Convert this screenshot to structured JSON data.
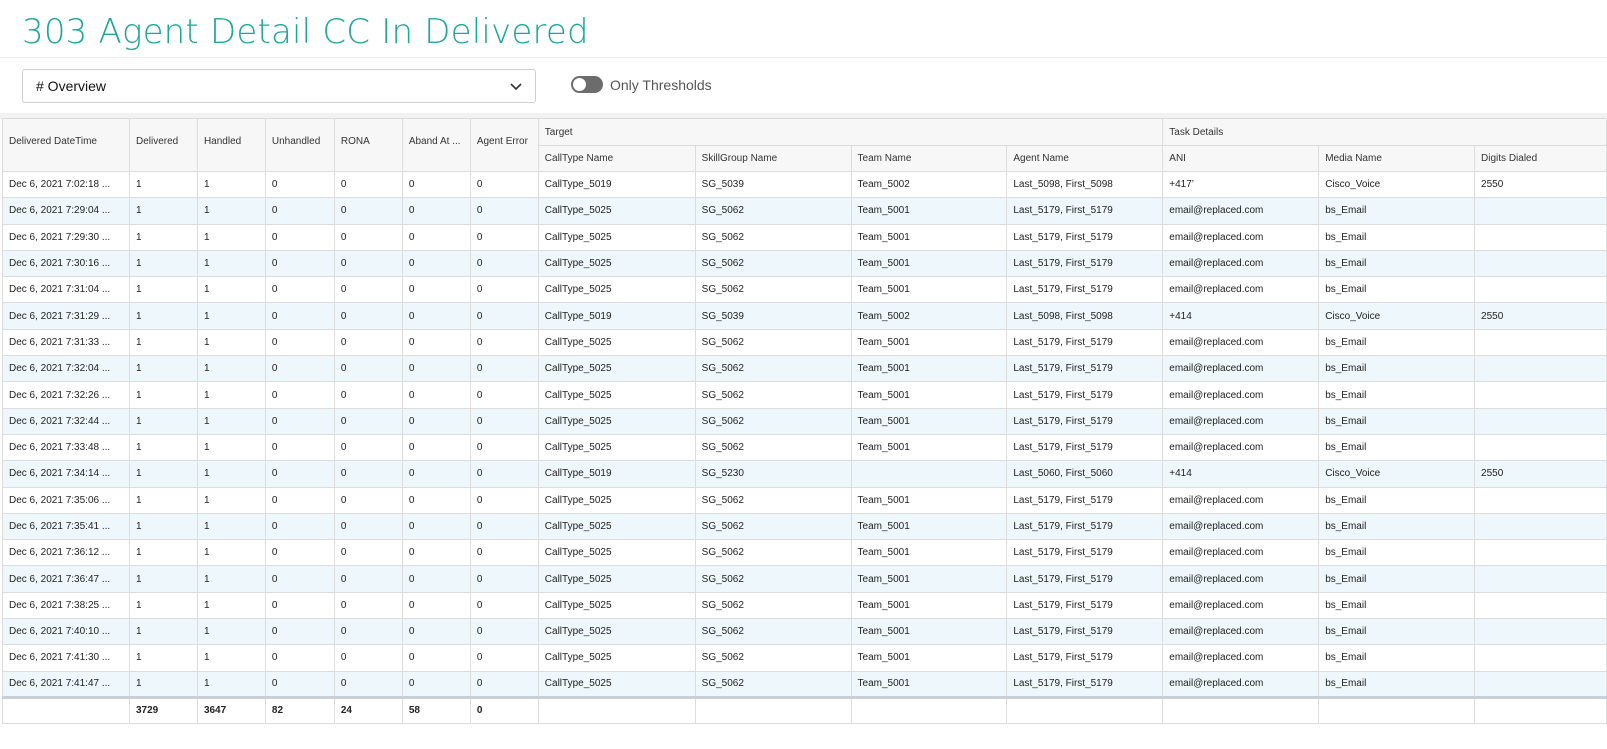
{
  "page": {
    "title": "303 Agent Detail CC In Delivered"
  },
  "view_select": {
    "value": "# Overview"
  },
  "thresholds_toggle": {
    "label": "Only Thresholds",
    "on": false
  },
  "grid": {
    "groups": {
      "target": "Target",
      "task": "Task Details"
    },
    "columns": {
      "datetime": "Delivered DateTime",
      "delivered": "Delivered",
      "handled": "Handled",
      "unhandled": "Unhandled",
      "rona": "RONA",
      "aband": "Aband At ...",
      "agent_error": "Agent Error",
      "calltype": "CallType Name",
      "skillgroup": "SkillGroup Name",
      "team": "Team Name",
      "agent": "Agent Name",
      "ani": "ANI",
      "media": "Media Name",
      "digits": "Digits Dialed"
    },
    "rows": [
      [
        "Dec 6, 2021 7:02:18 ...",
        "1",
        "1",
        "0",
        "0",
        "0",
        "0",
        "CallType_5019",
        "SG_5039",
        "Team_5002",
        "Last_5098, First_5098",
        "+417’",
        "Cisco_Voice",
        "2550"
      ],
      [
        "Dec 6, 2021 7:29:04 ...",
        "1",
        "1",
        "0",
        "0",
        "0",
        "0",
        "CallType_5025",
        "SG_5062",
        "Team_5001",
        "Last_5179, First_5179",
        "email@replaced.com",
        "bs_Email",
        ""
      ],
      [
        "Dec 6, 2021 7:29:30 ...",
        "1",
        "1",
        "0",
        "0",
        "0",
        "0",
        "CallType_5025",
        "SG_5062",
        "Team_5001",
        "Last_5179, First_5179",
        "email@replaced.com",
        "bs_Email",
        ""
      ],
      [
        "Dec 6, 2021 7:30:16 ...",
        "1",
        "1",
        "0",
        "0",
        "0",
        "0",
        "CallType_5025",
        "SG_5062",
        "Team_5001",
        "Last_5179, First_5179",
        "email@replaced.com",
        "bs_Email",
        ""
      ],
      [
        "Dec 6, 2021 7:31:04 ...",
        "1",
        "1",
        "0",
        "0",
        "0",
        "0",
        "CallType_5025",
        "SG_5062",
        "Team_5001",
        "Last_5179, First_5179",
        "email@replaced.com",
        "bs_Email",
        ""
      ],
      [
        "Dec 6, 2021 7:31:29 ...",
        "1",
        "1",
        "0",
        "0",
        "0",
        "0",
        "CallType_5019",
        "SG_5039",
        "Team_5002",
        "Last_5098, First_5098",
        "+414",
        "Cisco_Voice",
        "2550"
      ],
      [
        "Dec 6, 2021 7:31:33 ...",
        "1",
        "1",
        "0",
        "0",
        "0",
        "0",
        "CallType_5025",
        "SG_5062",
        "Team_5001",
        "Last_5179, First_5179",
        "email@replaced.com",
        "bs_Email",
        ""
      ],
      [
        "Dec 6, 2021 7:32:04 ...",
        "1",
        "1",
        "0",
        "0",
        "0",
        "0",
        "CallType_5025",
        "SG_5062",
        "Team_5001",
        "Last_5179, First_5179",
        "email@replaced.com",
        "bs_Email",
        ""
      ],
      [
        "Dec 6, 2021 7:32:26 ...",
        "1",
        "1",
        "0",
        "0",
        "0",
        "0",
        "CallType_5025",
        "SG_5062",
        "Team_5001",
        "Last_5179, First_5179",
        "email@replaced.com",
        "bs_Email",
        ""
      ],
      [
        "Dec 6, 2021 7:32:44 ...",
        "1",
        "1",
        "0",
        "0",
        "0",
        "0",
        "CallType_5025",
        "SG_5062",
        "Team_5001",
        "Last_5179, First_5179",
        "email@replaced.com",
        "bs_Email",
        ""
      ],
      [
        "Dec 6, 2021 7:33:48 ...",
        "1",
        "1",
        "0",
        "0",
        "0",
        "0",
        "CallType_5025",
        "SG_5062",
        "Team_5001",
        "Last_5179, First_5179",
        "email@replaced.com",
        "bs_Email",
        ""
      ],
      [
        "Dec 6, 2021 7:34:14 ...",
        "1",
        "1",
        "0",
        "0",
        "0",
        "0",
        "CallType_5019",
        "SG_5230",
        "",
        "Last_5060, First_5060",
        "+414",
        "Cisco_Voice",
        "2550"
      ],
      [
        "Dec 6, 2021 7:35:06 ...",
        "1",
        "1",
        "0",
        "0",
        "0",
        "0",
        "CallType_5025",
        "SG_5062",
        "Team_5001",
        "Last_5179, First_5179",
        "email@replaced.com",
        "bs_Email",
        ""
      ],
      [
        "Dec 6, 2021 7:35:41 ...",
        "1",
        "1",
        "0",
        "0",
        "0",
        "0",
        "CallType_5025",
        "SG_5062",
        "Team_5001",
        "Last_5179, First_5179",
        "email@replaced.com",
        "bs_Email",
        ""
      ],
      [
        "Dec 6, 2021 7:36:12 ...",
        "1",
        "1",
        "0",
        "0",
        "0",
        "0",
        "CallType_5025",
        "SG_5062",
        "Team_5001",
        "Last_5179, First_5179",
        "email@replaced.com",
        "bs_Email",
        ""
      ],
      [
        "Dec 6, 2021 7:36:47 ...",
        "1",
        "1",
        "0",
        "0",
        "0",
        "0",
        "CallType_5025",
        "SG_5062",
        "Team_5001",
        "Last_5179, First_5179",
        "email@replaced.com",
        "bs_Email",
        ""
      ],
      [
        "Dec 6, 2021 7:38:25 ...",
        "1",
        "1",
        "0",
        "0",
        "0",
        "0",
        "CallType_5025",
        "SG_5062",
        "Team_5001",
        "Last_5179, First_5179",
        "email@replaced.com",
        "bs_Email",
        ""
      ],
      [
        "Dec 6, 2021 7:40:10 ...",
        "1",
        "1",
        "0",
        "0",
        "0",
        "0",
        "CallType_5025",
        "SG_5062",
        "Team_5001",
        "Last_5179, First_5179",
        "email@replaced.com",
        "bs_Email",
        ""
      ],
      [
        "Dec 6, 2021 7:41:30 ...",
        "1",
        "1",
        "0",
        "0",
        "0",
        "0",
        "CallType_5025",
        "SG_5062",
        "Team_5001",
        "Last_5179, First_5179",
        "email@replaced.com",
        "bs_Email",
        ""
      ],
      [
        "Dec 6, 2021 7:41:47 ...",
        "1",
        "1",
        "0",
        "0",
        "0",
        "0",
        "CallType_5025",
        "SG_5062",
        "Team_5001",
        "Last_5179, First_5179",
        "email@replaced.com",
        "bs_Email",
        ""
      ]
    ],
    "totals": [
      "",
      "3729",
      "3647",
      "82",
      "24",
      "58",
      "0",
      "",
      "",
      "",
      "",
      "",
      "",
      ""
    ]
  }
}
